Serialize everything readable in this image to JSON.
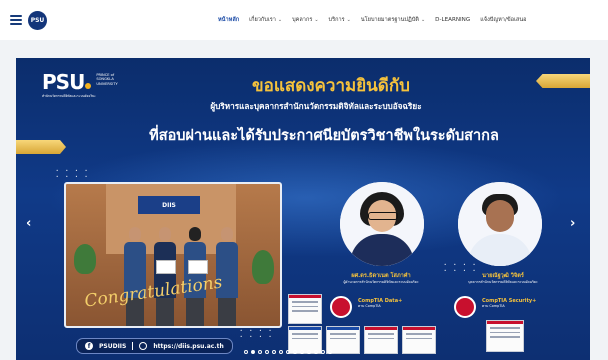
{
  "header": {
    "logo_text": "PSU",
    "nav": [
      {
        "label": "หน้าหลัก",
        "active": true,
        "dropdown": false
      },
      {
        "label": "เกี่ยวกับเรา",
        "active": false,
        "dropdown": true
      },
      {
        "label": "บุคลากร",
        "active": false,
        "dropdown": true
      },
      {
        "label": "บริการ",
        "active": false,
        "dropdown": true
      },
      {
        "label": "นโยบายมาตรฐานปฏิบัติ",
        "active": false,
        "dropdown": true
      },
      {
        "label": "D-LEARNING",
        "active": false,
        "dropdown": false
      },
      {
        "label": "แจ้งปัญหา/ข้อเสนอ",
        "active": false,
        "dropdown": false
      }
    ],
    "accent_color": "#1a4aa6"
  },
  "banner": {
    "org_logo_mark": "PSU",
    "org_logo_lines": [
      "PRINCE of",
      "SONGKLA",
      "UNIVERSITY"
    ],
    "org_logo_under": "สำนักนวัตกรรมดิจิทัลและระบบอัจฉริยะ",
    "headline": "ขอแสดงความยินดีกับ",
    "subheadline": "ผู้บริหารและบุคลากรสำนักนวัตกรรมดิจิทัลและระบบอัจฉริยะ",
    "headline2": "ที่สอบผ่านและได้รับประกาศนียบัตรวิชาชีพในระดับสากล",
    "photo_sign": "DIIS",
    "congrats_text": "Congratulations",
    "person1": {
      "name": "ผศ.ดร.ธิดาเนต โสภาคำ",
      "role": "ผู้อำนวยการสำนักนวัตกรรมดิจิทัลและระบบอัจฉริยะ",
      "cert": "CompTIA Data+",
      "cert_by": "ตาม CompTIA"
    },
    "person2": {
      "name": "นายณัฐวุฒิ วิจิตร์",
      "role": "บุคลากรสำนักนวัตกรรมดิจิทัลและระบบอัจฉริยะ",
      "cert": "CompTIA Security+",
      "cert_by": "ตาม CompTIA"
    },
    "social_handle": "PSUDIIS",
    "social_url": "https://diis.psu.ac.th",
    "slide_count": 13,
    "active_slide": 1,
    "colors": {
      "navy": "#0b2d6c",
      "gold": "#f5c23c"
    }
  }
}
